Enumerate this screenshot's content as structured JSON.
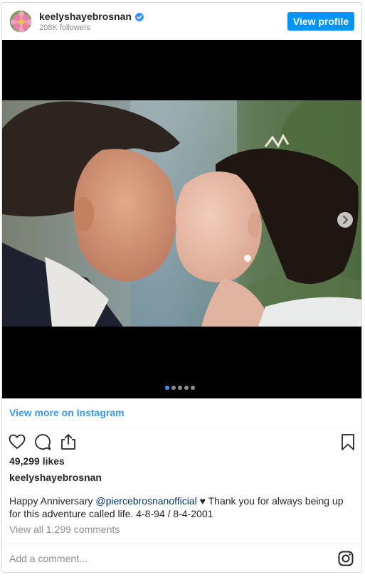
{
  "header": {
    "username": "keelyshayebrosnan",
    "followers": "208K followers",
    "view_profile_label": "View profile",
    "verified": true
  },
  "media": {
    "slide_count": 5,
    "active_slide": 1,
    "next_icon": "chevron-right-icon"
  },
  "links": {
    "view_more": "View more on Instagram"
  },
  "actions": {
    "icons": [
      "heart-icon",
      "comment-icon",
      "share-icon",
      "bookmark-icon"
    ]
  },
  "post": {
    "likes": "49,299 likes",
    "owner": "keelyshayebrosnan",
    "caption_prefix": "Happy Anniversary ",
    "caption_mention": "@piercebrosnanofficial",
    "caption_suffix": " ♥ Thank you for always being up for this adventure called life. 4-8-94 / 8-4-2001",
    "view_comments": "View all 1,299 comments"
  },
  "comment": {
    "placeholder": "Add a comment..."
  },
  "colors": {
    "accent": "#0095f6",
    "link": "#3897f0",
    "mention": "#003569",
    "muted": "#8e8e8e"
  }
}
